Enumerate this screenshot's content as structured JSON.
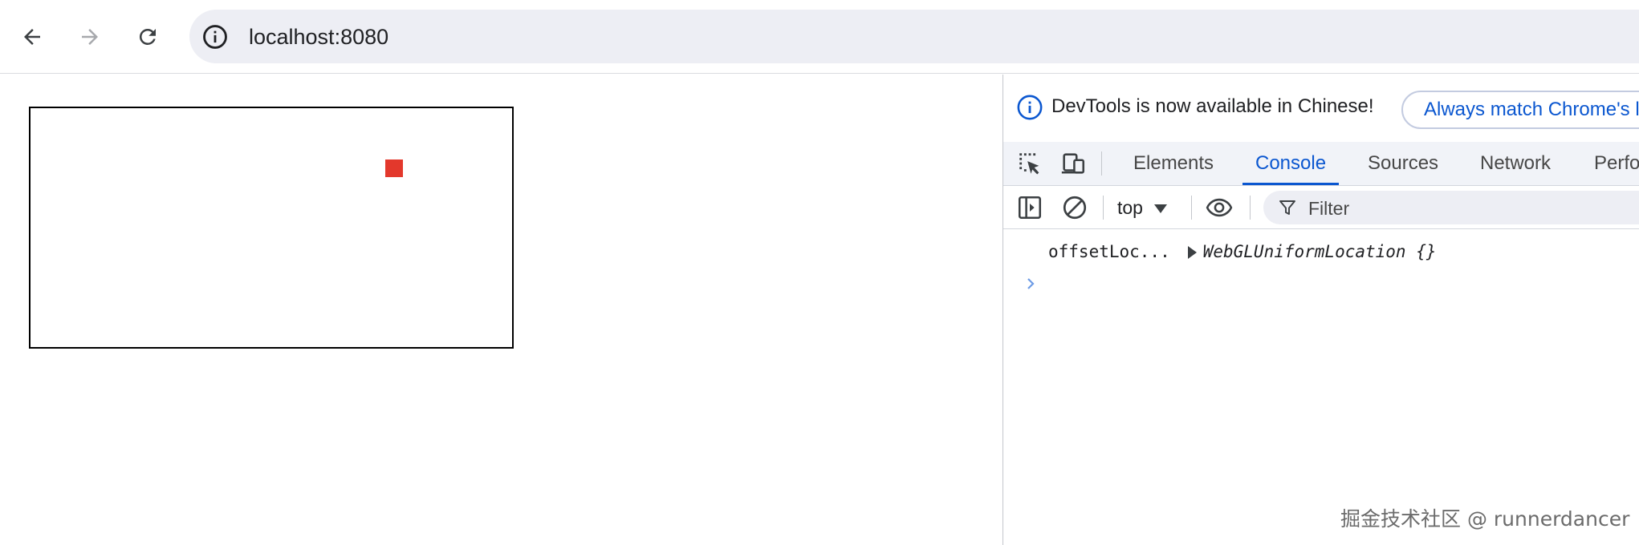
{
  "browser": {
    "back_icon": "arrow-left-icon",
    "forward_icon": "arrow-right-icon",
    "reload_icon": "reload-icon",
    "site_info_icon": "info-circle-icon",
    "url": "localhost:8080"
  },
  "page": {
    "canvas_color": "#ffffff",
    "square_color": "#e3382c"
  },
  "devtools": {
    "infobar": {
      "message": "DevTools is now available in Chinese!",
      "button_label": "Always match Chrome's la"
    },
    "tabs": [
      {
        "label": "Elements"
      },
      {
        "label": "Console"
      },
      {
        "label": "Sources"
      },
      {
        "label": "Network"
      },
      {
        "label": "Perfo"
      }
    ],
    "active_tab": "Console",
    "console": {
      "context": "top",
      "filter_placeholder": "Filter",
      "log_label": "offsetLoc...",
      "log_value": "WebGLUniformLocation {}"
    }
  },
  "watermark": "掘金技术社区 @ runnerdancer",
  "colors": {
    "accent": "#0b57d0",
    "omnibox": "#edeef4"
  }
}
